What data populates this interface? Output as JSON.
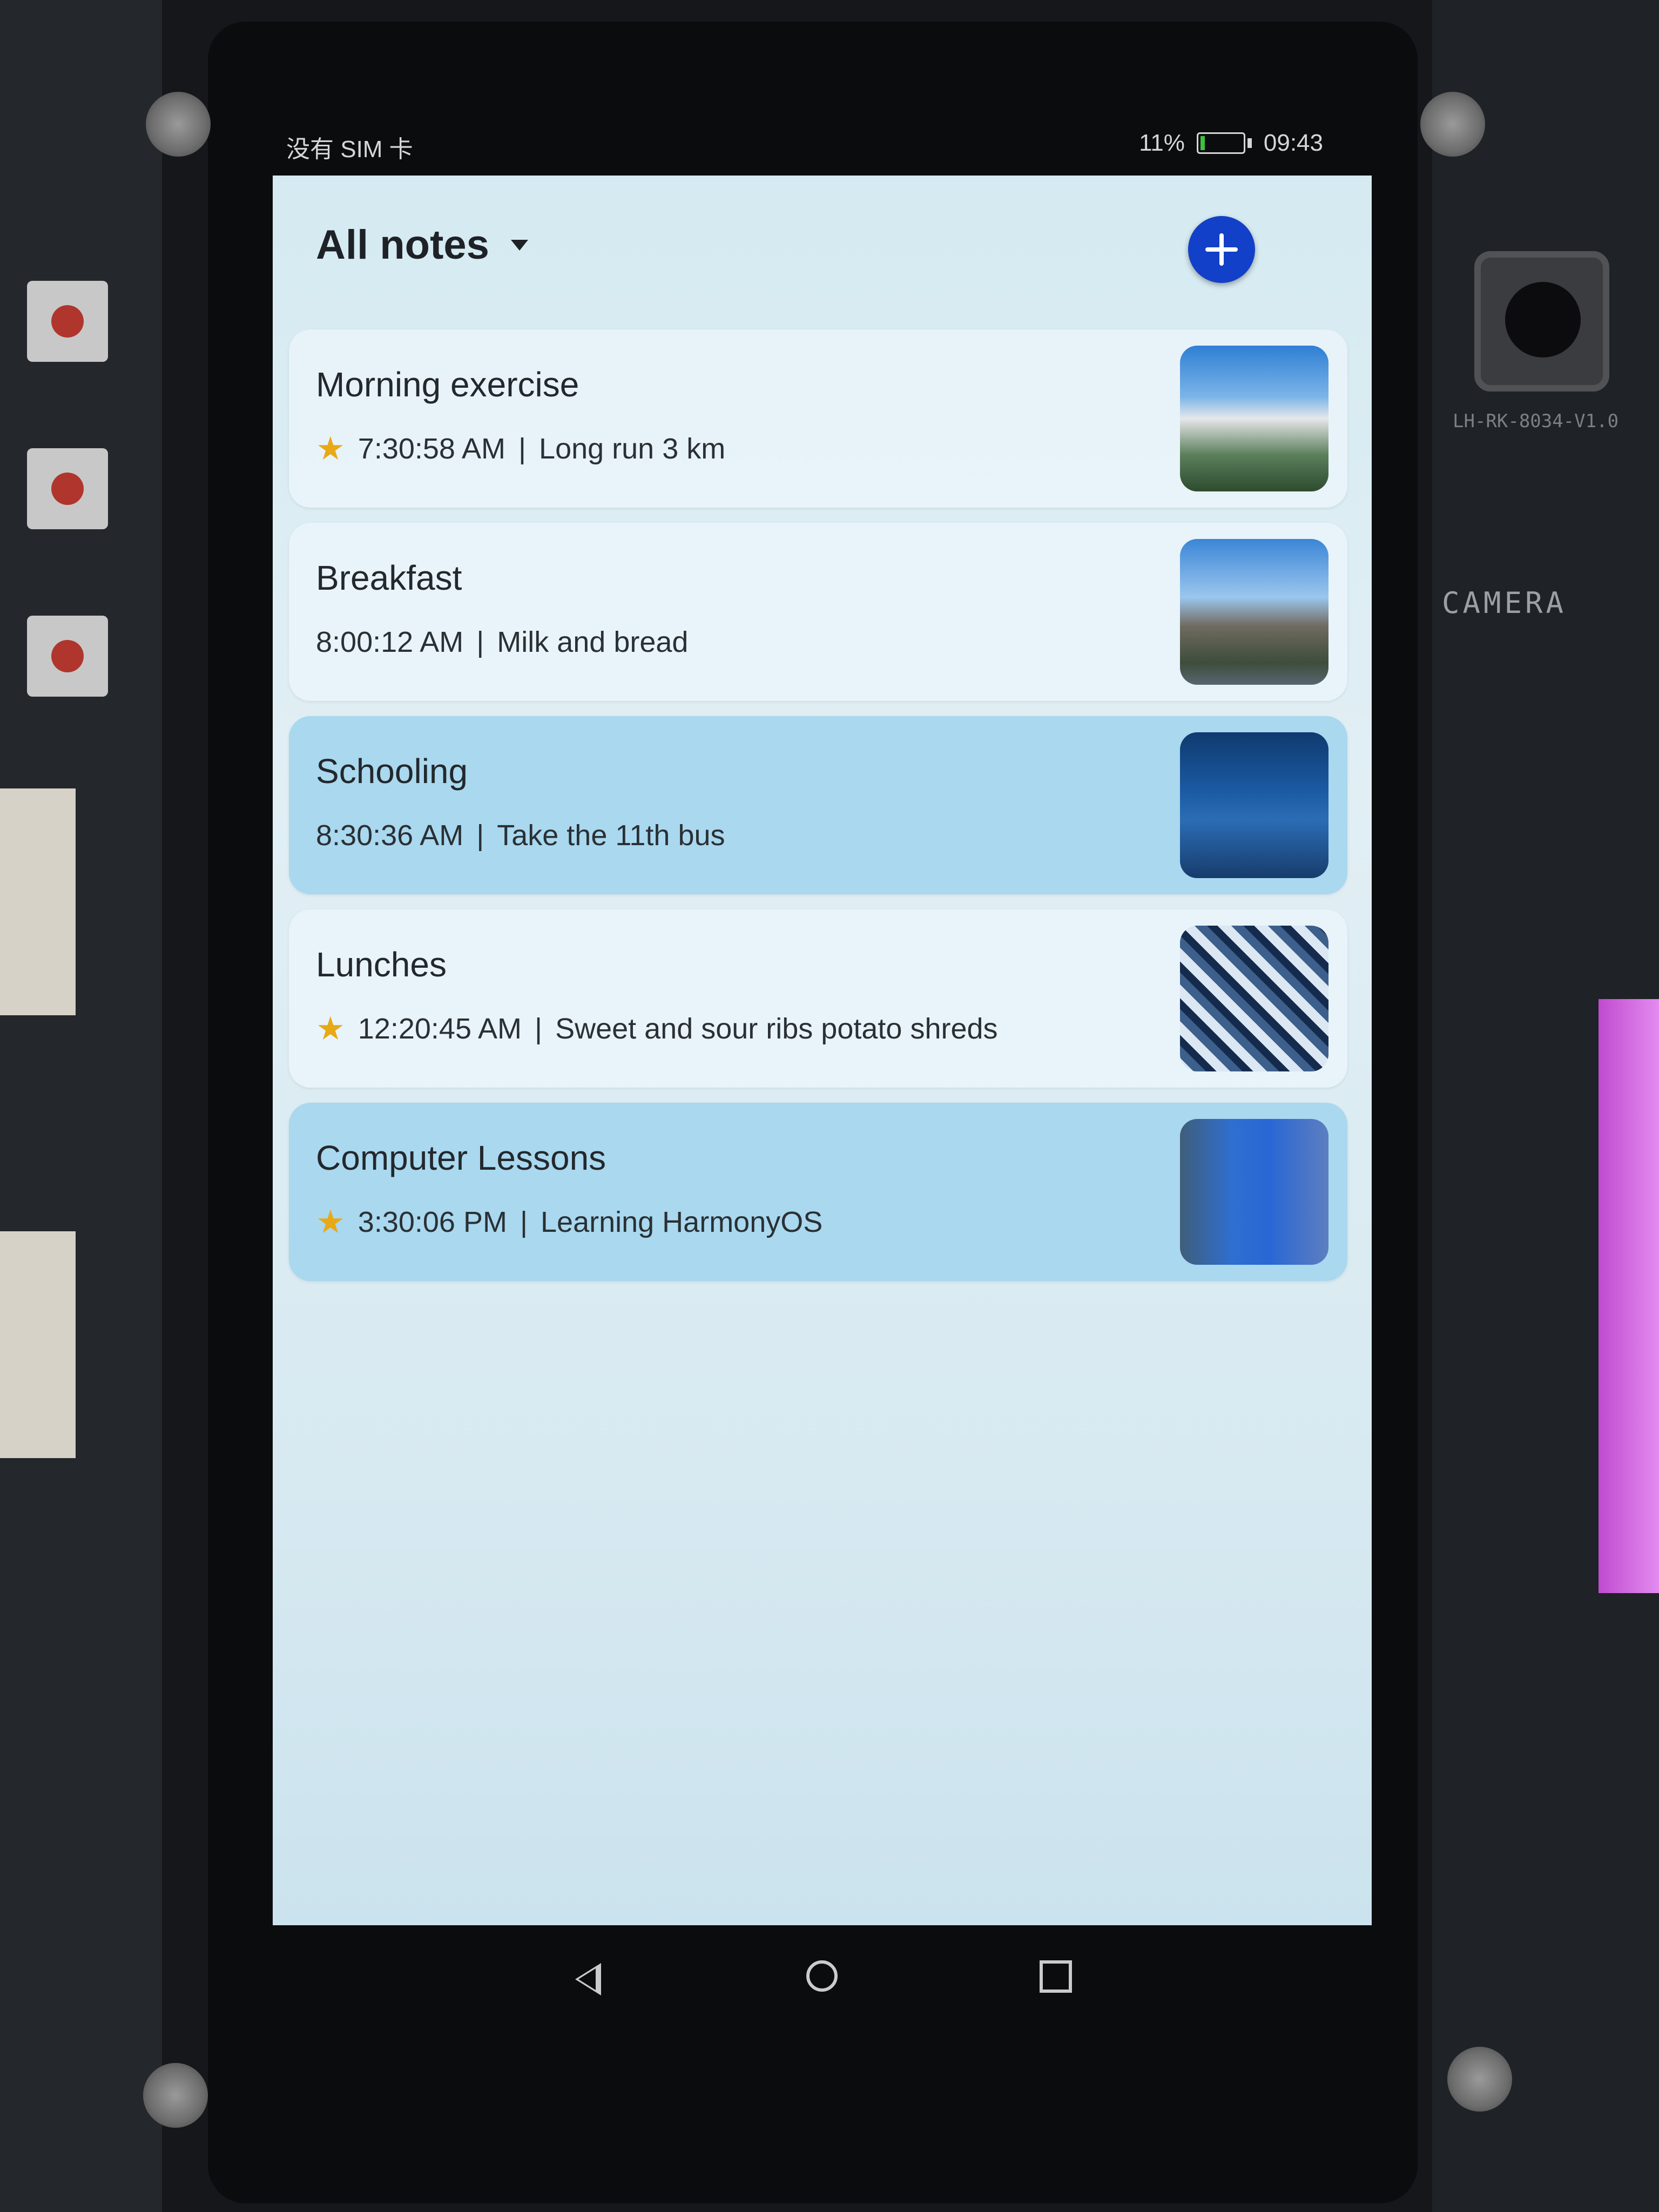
{
  "status_bar": {
    "carrier": "没有 SIM 卡",
    "battery": "11%",
    "time": "09:43"
  },
  "header": {
    "title": "All notes"
  },
  "notes": [
    {
      "title": "Morning exercise",
      "time": "7:30:58 AM",
      "detail": "Long run 3 km",
      "starred": true,
      "highlighted": false,
      "thumbnail": "castle-landscape"
    },
    {
      "title": "Breakfast",
      "time": "8:00:12 AM",
      "detail": "Milk and bread",
      "starred": false,
      "highlighted": false,
      "thumbnail": "palace-gate"
    },
    {
      "title": "Schooling",
      "time": "8:30:36 AM",
      "detail": "Take the 11th bus",
      "starred": false,
      "highlighted": true,
      "thumbnail": "lake-night"
    },
    {
      "title": "Lunches",
      "time": "12:20:45 AM",
      "detail": "Sweet and sour ribs potato shreds",
      "starred": true,
      "highlighted": false,
      "thumbnail": "snowy-tree"
    },
    {
      "title": "Computer Lessons",
      "time": "3:30:06 PM",
      "detail": "Learning HarmonyOS",
      "starred": true,
      "highlighted": true,
      "thumbnail": "river-autumn"
    }
  ],
  "board": {
    "camera_label": "CAMERA",
    "module_label": "LH-RK-8034-V1.0"
  },
  "colors": {
    "accent": "#1240c8",
    "highlight_row": "#a9d8ef",
    "star": "#e8a917",
    "screen_bg": "#dcecf3"
  }
}
